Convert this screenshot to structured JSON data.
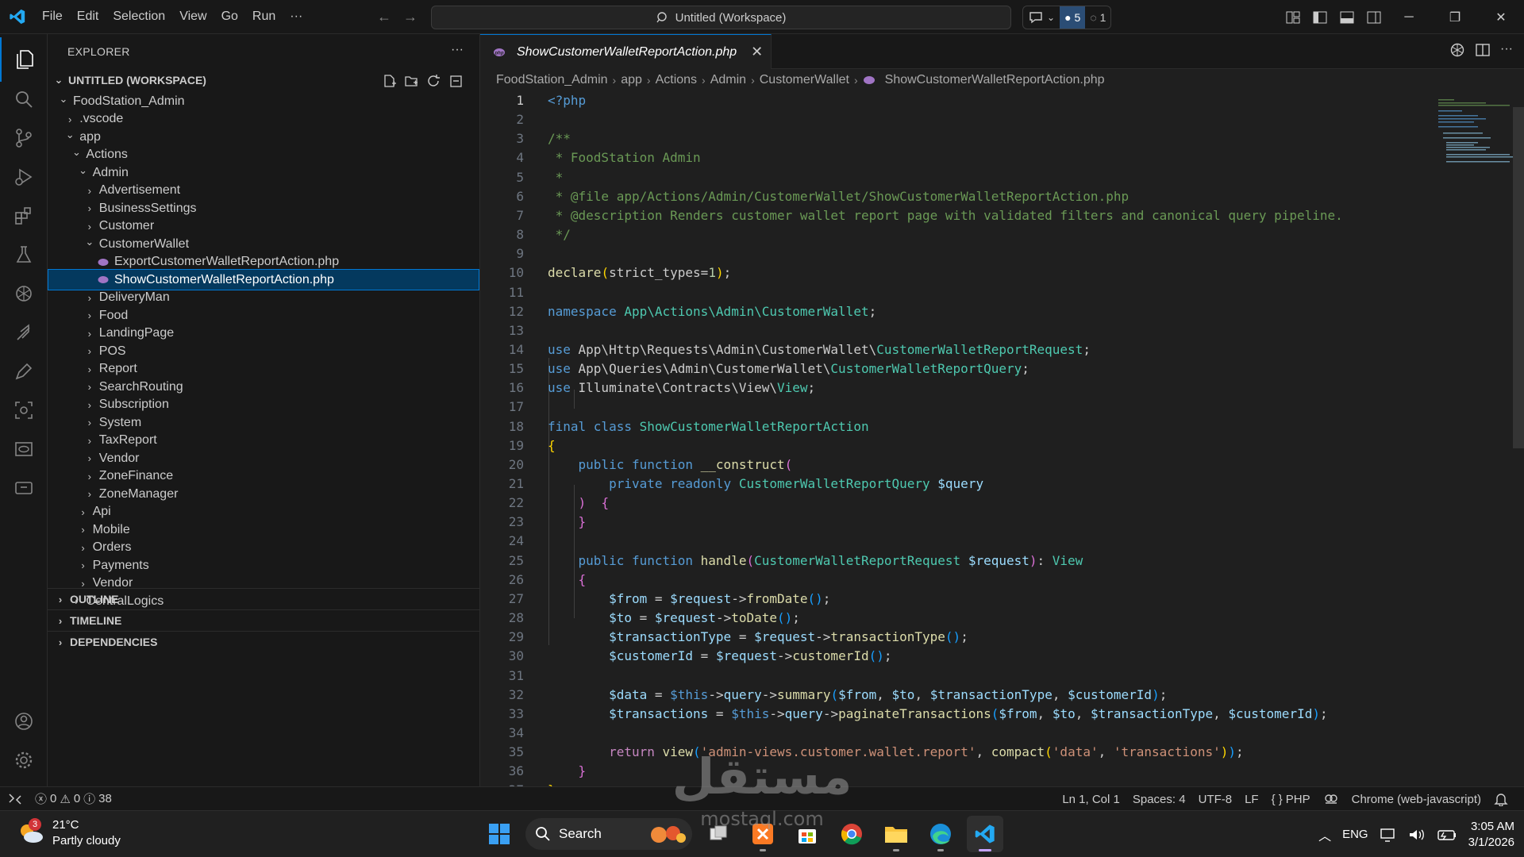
{
  "menu": [
    "File",
    "Edit",
    "Selection",
    "View",
    "Go",
    "Run",
    "···"
  ],
  "command_center": {
    "label": "Untitled (Workspace)"
  },
  "copilot": {
    "count_a": "5",
    "count_b": "1"
  },
  "explorer": {
    "title": "EXPLORER",
    "more": "···",
    "workspace": "UNTITLED (WORKSPACE)",
    "tree": [
      {
        "label": "FoodStation_Admin",
        "depth": 0,
        "type": "open"
      },
      {
        "label": ".vscode",
        "depth": 1,
        "type": "closed"
      },
      {
        "label": "app",
        "depth": 1,
        "type": "open"
      },
      {
        "label": "Actions",
        "depth": 2,
        "type": "open"
      },
      {
        "label": "Admin",
        "depth": 3,
        "type": "open"
      },
      {
        "label": "Advertisement",
        "depth": 4,
        "type": "closed"
      },
      {
        "label": "BusinessSettings",
        "depth": 4,
        "type": "closed"
      },
      {
        "label": "Customer",
        "depth": 4,
        "type": "closed"
      },
      {
        "label": "CustomerWallet",
        "depth": 4,
        "type": "open"
      },
      {
        "label": "ExportCustomerWalletReportAction.php",
        "depth": 5,
        "type": "php"
      },
      {
        "label": "ShowCustomerWalletReportAction.php",
        "depth": 5,
        "type": "php",
        "selected": true
      },
      {
        "label": "DeliveryMan",
        "depth": 4,
        "type": "closed"
      },
      {
        "label": "Food",
        "depth": 4,
        "type": "closed"
      },
      {
        "label": "LandingPage",
        "depth": 4,
        "type": "closed"
      },
      {
        "label": "POS",
        "depth": 4,
        "type": "closed"
      },
      {
        "label": "Report",
        "depth": 4,
        "type": "closed"
      },
      {
        "label": "SearchRouting",
        "depth": 4,
        "type": "closed"
      },
      {
        "label": "Subscription",
        "depth": 4,
        "type": "closed"
      },
      {
        "label": "System",
        "depth": 4,
        "type": "closed"
      },
      {
        "label": "TaxReport",
        "depth": 4,
        "type": "closed"
      },
      {
        "label": "Vendor",
        "depth": 4,
        "type": "closed"
      },
      {
        "label": "ZoneFinance",
        "depth": 4,
        "type": "closed"
      },
      {
        "label": "ZoneManager",
        "depth": 4,
        "type": "closed"
      },
      {
        "label": "Api",
        "depth": 3,
        "type": "closed"
      },
      {
        "label": "Mobile",
        "depth": 3,
        "type": "closed"
      },
      {
        "label": "Orders",
        "depth": 3,
        "type": "closed"
      },
      {
        "label": "Payments",
        "depth": 3,
        "type": "closed"
      },
      {
        "label": "Vendor",
        "depth": 3,
        "type": "closed"
      },
      {
        "label": "CentralLogics",
        "depth": 2,
        "type": "closed"
      }
    ],
    "panels": [
      "OUTLINE",
      "TIMELINE",
      "DEPENDENCIES"
    ]
  },
  "editor": {
    "tab_label": "ShowCustomerWalletReportAction.php",
    "breadcrumb": [
      "FoodStation_Admin",
      "app",
      "Actions",
      "Admin",
      "CustomerWallet",
      "ShowCustomerWalletReportAction.php"
    ],
    "lines": [
      [
        [
          "kw",
          "<?php"
        ]
      ],
      [],
      [
        [
          "cm",
          "/**"
        ]
      ],
      [
        [
          "cm",
          " * FoodStation Admin"
        ]
      ],
      [
        [
          "cm",
          " *"
        ]
      ],
      [
        [
          "cm",
          " * @file app/Actions/Admin/CustomerWallet/ShowCustomerWalletReportAction.php"
        ]
      ],
      [
        [
          "cm",
          " * @description Renders customer wallet report page with validated filters and canonical query pipeline."
        ]
      ],
      [
        [
          "cm",
          " */"
        ]
      ],
      [],
      [
        [
          "fn",
          "declare"
        ],
        [
          "br1",
          "("
        ],
        [
          "",
          "strict_types"
        ],
        [
          "",
          "="
        ],
        [
          "num",
          "1"
        ],
        [
          "br1",
          ")"
        ],
        [
          "",
          ";"
        ]
      ],
      [],
      [
        [
          "kw",
          "namespace "
        ],
        [
          "cls",
          "App\\Actions\\Admin\\CustomerWallet"
        ],
        [
          "",
          ";"
        ]
      ],
      [],
      [
        [
          "kw",
          "use "
        ],
        [
          "",
          "App\\Http\\Requests\\Admin\\CustomerWallet\\"
        ],
        [
          "cls",
          "CustomerWalletReportRequest"
        ],
        [
          "",
          ";"
        ]
      ],
      [
        [
          "kw",
          "use "
        ],
        [
          "",
          "App\\Queries\\Admin\\CustomerWallet\\"
        ],
        [
          "cls",
          "CustomerWalletReportQuery"
        ],
        [
          "",
          ";"
        ]
      ],
      [
        [
          "kw",
          "use "
        ],
        [
          "",
          "Illuminate\\Contracts\\View\\"
        ],
        [
          "cls",
          "View"
        ],
        [
          "",
          ";"
        ]
      ],
      [],
      [
        [
          "kw",
          "final class "
        ],
        [
          "cls",
          "ShowCustomerWalletReportAction"
        ]
      ],
      [
        [
          "br1",
          "{"
        ]
      ],
      [
        [
          "",
          "    "
        ],
        [
          "kw",
          "public function "
        ],
        [
          "fn",
          "__construct"
        ],
        [
          "br2",
          "("
        ]
      ],
      [
        [
          "",
          "        "
        ],
        [
          "kw",
          "private readonly "
        ],
        [
          "cls",
          "CustomerWalletReportQuery "
        ],
        [
          "var",
          "$query"
        ]
      ],
      [
        [
          "",
          "    "
        ],
        [
          "br2",
          ")"
        ],
        [
          "",
          "  "
        ],
        [
          "br2",
          "{"
        ]
      ],
      [
        [
          "",
          "    "
        ],
        [
          "br2",
          "}"
        ]
      ],
      [],
      [
        [
          "",
          "    "
        ],
        [
          "kw",
          "public function "
        ],
        [
          "fn",
          "handle"
        ],
        [
          "br2",
          "("
        ],
        [
          "cls",
          "CustomerWalletReportRequest "
        ],
        [
          "var",
          "$request"
        ],
        [
          "br2",
          ")"
        ],
        [
          "",
          ": "
        ],
        [
          "cls",
          "View"
        ]
      ],
      [
        [
          "",
          "    "
        ],
        [
          "br2",
          "{"
        ]
      ],
      [
        [
          "",
          "        "
        ],
        [
          "var",
          "$from"
        ],
        [
          "",
          " = "
        ],
        [
          "var",
          "$request"
        ],
        [
          "",
          "->"
        ],
        [
          "fn",
          "fromDate"
        ],
        [
          "br3",
          "()"
        ],
        [
          "",
          ";"
        ]
      ],
      [
        [
          "",
          "        "
        ],
        [
          "var",
          "$to"
        ],
        [
          "",
          " = "
        ],
        [
          "var",
          "$request"
        ],
        [
          "",
          "->"
        ],
        [
          "fn",
          "toDate"
        ],
        [
          "br3",
          "()"
        ],
        [
          "",
          ";"
        ]
      ],
      [
        [
          "",
          "        "
        ],
        [
          "var",
          "$transactionType"
        ],
        [
          "",
          " = "
        ],
        [
          "var",
          "$request"
        ],
        [
          "",
          "->"
        ],
        [
          "fn",
          "transactionType"
        ],
        [
          "br3",
          "()"
        ],
        [
          "",
          ";"
        ]
      ],
      [
        [
          "",
          "        "
        ],
        [
          "var",
          "$customerId"
        ],
        [
          "",
          " = "
        ],
        [
          "var",
          "$request"
        ],
        [
          "",
          "->"
        ],
        [
          "fn",
          "customerId"
        ],
        [
          "br3",
          "()"
        ],
        [
          "",
          ";"
        ]
      ],
      [],
      [
        [
          "",
          "        "
        ],
        [
          "var",
          "$data"
        ],
        [
          "",
          " = "
        ],
        [
          "kw",
          "$this"
        ],
        [
          "",
          "->"
        ],
        [
          "var",
          "query"
        ],
        [
          "",
          "->"
        ],
        [
          "fn",
          "summary"
        ],
        [
          "br3",
          "("
        ],
        [
          "var",
          "$from"
        ],
        [
          "",
          ", "
        ],
        [
          "var",
          "$to"
        ],
        [
          "",
          ", "
        ],
        [
          "var",
          "$transactionType"
        ],
        [
          "",
          ", "
        ],
        [
          "var",
          "$customerId"
        ],
        [
          "br3",
          ")"
        ],
        [
          "",
          ";"
        ]
      ],
      [
        [
          "",
          "        "
        ],
        [
          "var",
          "$transactions"
        ],
        [
          "",
          " = "
        ],
        [
          "kw",
          "$this"
        ],
        [
          "",
          "->"
        ],
        [
          "var",
          "query"
        ],
        [
          "",
          "->"
        ],
        [
          "fn",
          "paginateTransactions"
        ],
        [
          "br3",
          "("
        ],
        [
          "var",
          "$from"
        ],
        [
          "",
          ", "
        ],
        [
          "var",
          "$to"
        ],
        [
          "",
          ", "
        ],
        [
          "var",
          "$transactionType"
        ],
        [
          "",
          ", "
        ],
        [
          "var",
          "$customerId"
        ],
        [
          "br3",
          ")"
        ],
        [
          "",
          ";"
        ]
      ],
      [],
      [
        [
          "",
          "        "
        ],
        [
          "ctl",
          "return "
        ],
        [
          "fn",
          "view"
        ],
        [
          "br3",
          "("
        ],
        [
          "str",
          "'admin-views.customer.wallet.report'"
        ],
        [
          "",
          ", "
        ],
        [
          "fn",
          "compact"
        ],
        [
          "br1",
          "("
        ],
        [
          "str",
          "'data'"
        ],
        [
          "",
          ", "
        ],
        [
          "str",
          "'transactions'"
        ],
        [
          "br1",
          ")"
        ],
        [
          "br3",
          ")"
        ],
        [
          "",
          ";"
        ]
      ],
      [
        [
          "",
          "    "
        ],
        [
          "br2",
          "}"
        ]
      ],
      [
        [
          "br1",
          "}"
        ]
      ]
    ]
  },
  "status": {
    "errors": "0",
    "warnings": "0",
    "infos": "38",
    "position": "Ln 1, Col 1",
    "spaces": "Spaces: 4",
    "encoding": "UTF-8",
    "eol": "LF",
    "language": "PHP",
    "debug_target": "Chrome (web-javascript)"
  },
  "taskbar": {
    "weather_badge": "3",
    "temp": "21°C",
    "weather": "Partly cloudy",
    "search": "Search",
    "lang": "ENG",
    "time": "3:05 AM",
    "date": "3/1/2026"
  },
  "watermark": {
    "text": "مستقل",
    "sub": "mostaql.com"
  },
  "colors": {
    "accent": "#0078d4",
    "selection": "#04395e",
    "php_icon": "#a074c4"
  }
}
